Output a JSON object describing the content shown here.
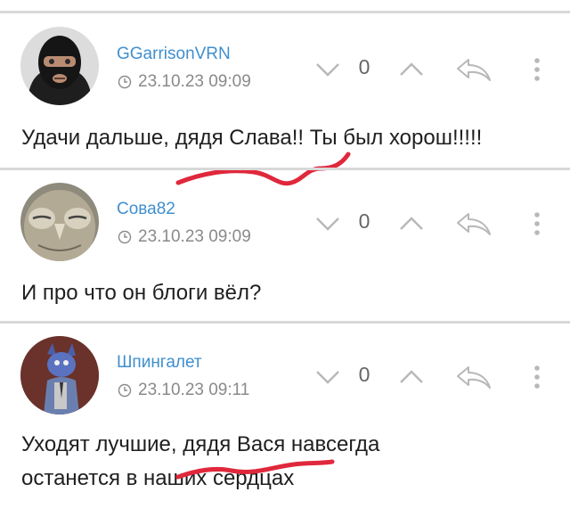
{
  "comments": [
    {
      "username": "GGarrisonVRN",
      "timestamp": "23.10.23 09:09",
      "vote_count": "0",
      "text_lines": [
        "Удачи дальше, дядя Слава!! Ты был хорош!!!!!"
      ],
      "avatar": "balaclava-avatar"
    },
    {
      "username": "Сова82",
      "timestamp": "23.10.23 09:09",
      "vote_count": "0",
      "text_lines": [
        "И про что он блоги вёл?"
      ],
      "avatar": "owl-avatar"
    },
    {
      "username": "Шпингалет",
      "timestamp": "23.10.23 09:11",
      "vote_count": "0",
      "text_lines": [
        "Уходят лучшие, дядя Вася навсегда",
        "останется в наших сердцах"
      ],
      "avatar": "cartoon-character-avatar"
    }
  ],
  "icons": {
    "downvote": "chevron-down-icon",
    "upvote": "chevron-up-icon",
    "reply": "reply-arrow-icon",
    "more": "more-vertical-icon",
    "clock": "clock-icon"
  },
  "colors": {
    "username": "#3f8fcf",
    "meta": "#8a8a8a",
    "icon": "#b8b8b8",
    "text": "#1f1f1f",
    "scribble": "#e0283c",
    "divider": "#d8d8d8"
  }
}
